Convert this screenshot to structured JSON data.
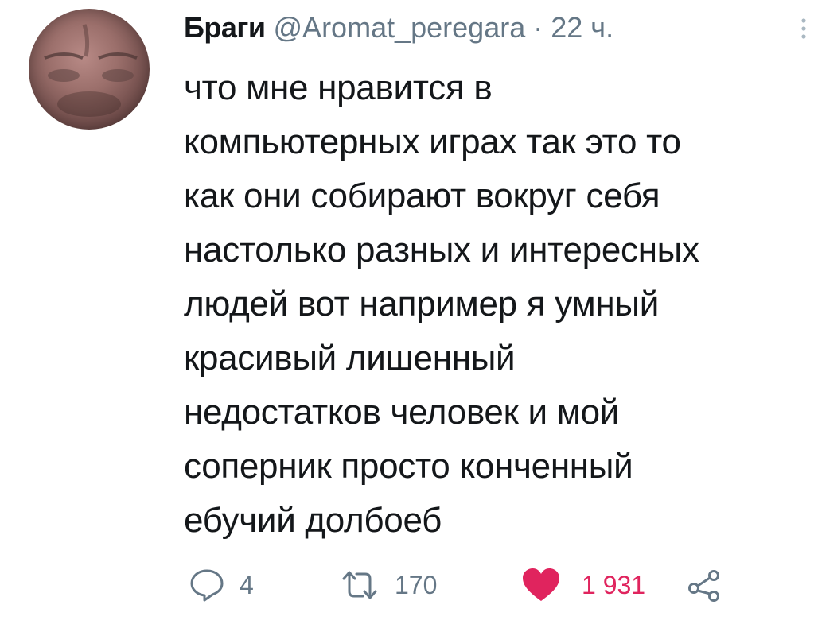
{
  "tweet": {
    "author": {
      "name": "Браги",
      "handle": "@Aromat_peregara",
      "avatar_icon": "avatar-photo"
    },
    "separator": "·",
    "timestamp": "22 ч.",
    "more_icon": "more-vertical-icon",
    "text": "что мне нравится в\nкомпьютерных играх так это то\nкак они собирают вокруг себя\nнастолько разных и интересных\nлюдей вот например я умный\nкрасивый лишенный\nнедостатков человек и мой\nсоперник просто конченный\nебучий долбоеб"
  },
  "actions": {
    "reply": {
      "icon": "reply-icon",
      "count": "4"
    },
    "retweet": {
      "icon": "retweet-icon",
      "count": "170"
    },
    "like": {
      "icon": "heart-icon",
      "count": "1 931",
      "active": true,
      "color": "#e0245e"
    },
    "share": {
      "icon": "share-icon"
    }
  },
  "colors": {
    "text": "#14171a",
    "secondary": "#657786",
    "like": "#e0245e"
  }
}
